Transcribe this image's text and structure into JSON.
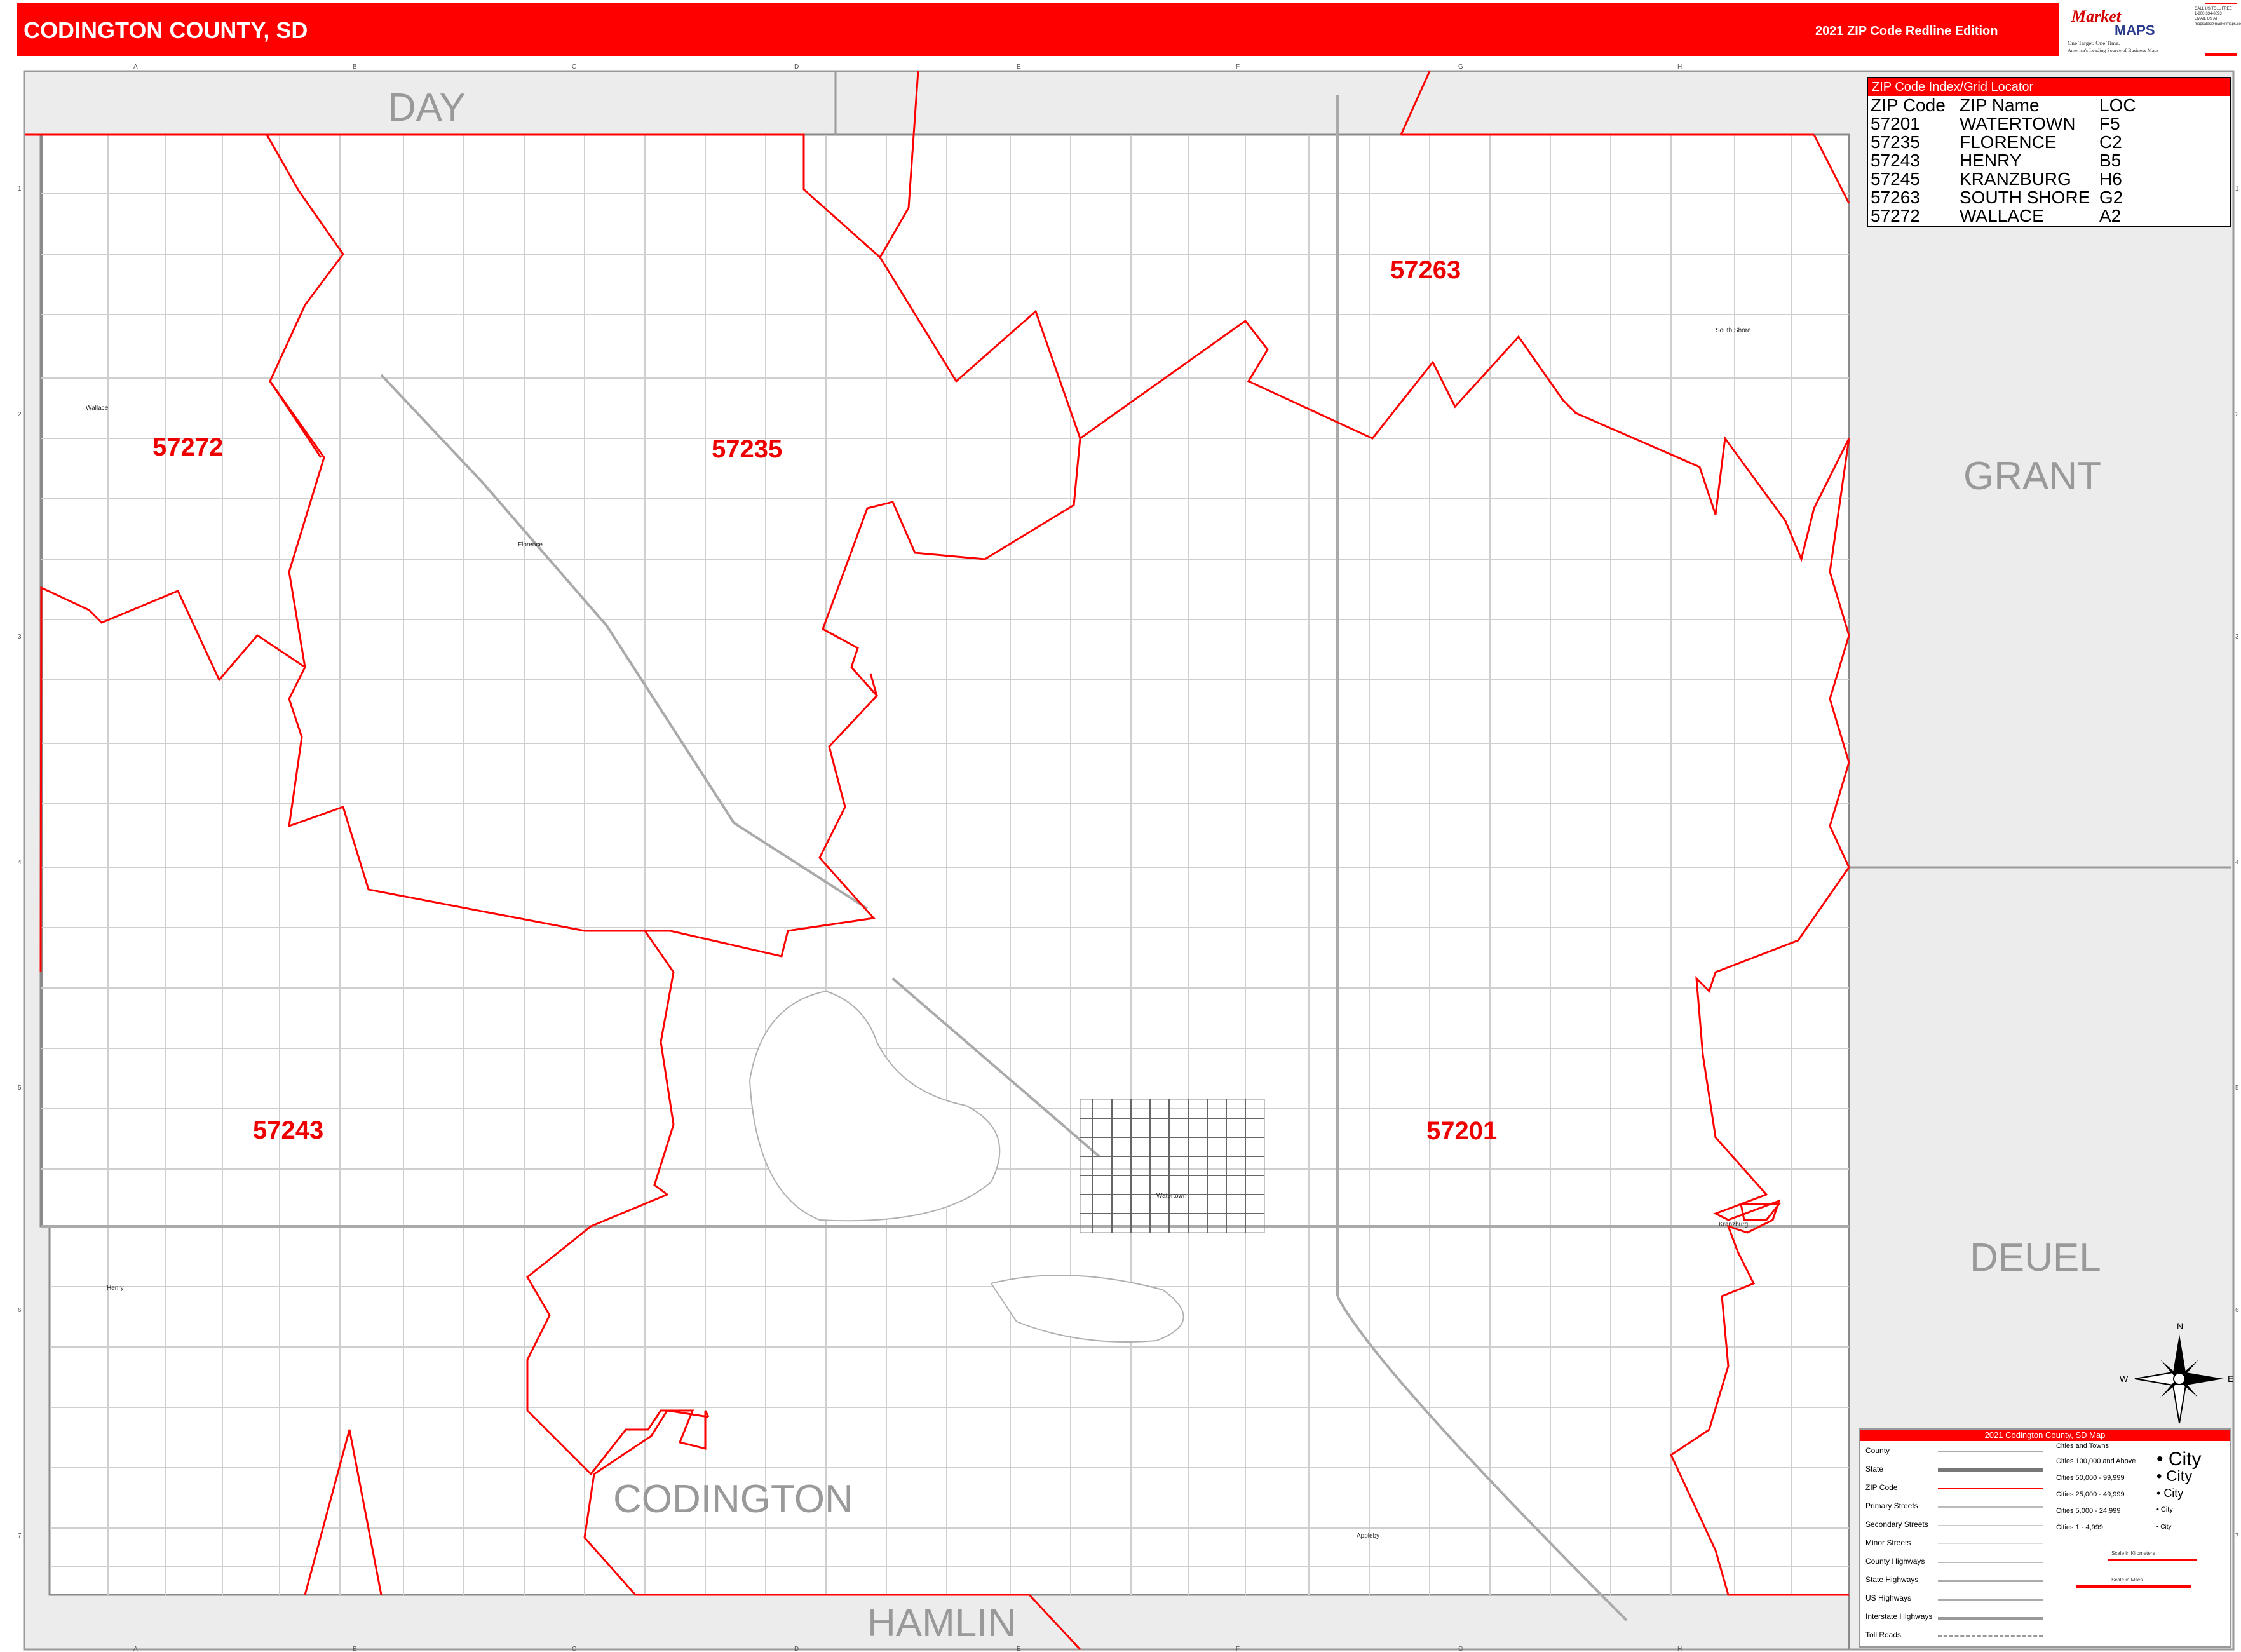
{
  "header": {
    "title": "CODINGTON COUNTY, SD",
    "edition": "2021 ZIP Code Redline Edition"
  },
  "logo": {
    "brand_top": "Market",
    "brand_bottom": "MAPS",
    "tagline": "One Target. One Time.",
    "subtagline": "America's Leading Source of Business Maps",
    "contact": "CALL US TOLL FREE 1-800-334-8093 EMAIL US AT mapsales@marketmaps.com"
  },
  "colors": {
    "zip_boundary": "#ff0000",
    "header_bg": "#ff0000",
    "outside_county": "#ececec",
    "grid_roads": "#cccccc"
  },
  "neighbors": [
    {
      "name": "DAY",
      "id": "day"
    },
    {
      "name": "GRANT",
      "id": "grant"
    },
    {
      "name": "DEUEL",
      "id": "deuel"
    },
    {
      "name": "CODINGTON",
      "id": "codington"
    },
    {
      "name": "HAMLIN",
      "id": "hamlin"
    }
  ],
  "zip_labels": [
    "57263",
    "57272",
    "57235",
    "57243",
    "57201"
  ],
  "places": [
    "Wallace",
    "Florence",
    "South Shore",
    "Watertown",
    "Kranzburg",
    "Henry",
    "Appleby"
  ],
  "grid": {
    "columns": [
      "A",
      "B",
      "C",
      "D",
      "E",
      "F",
      "G",
      "H"
    ],
    "rows": [
      "1",
      "2",
      "3",
      "4",
      "5",
      "6",
      "7"
    ]
  },
  "index": {
    "title": "ZIP Code Index/Grid Locator",
    "headers": [
      "ZIP Code",
      "ZIP Name",
      "LOC"
    ],
    "rows": [
      [
        "57201",
        "WATERTOWN",
        "F5"
      ],
      [
        "57235",
        "FLORENCE",
        "C2"
      ],
      [
        "57243",
        "HENRY",
        "B5"
      ],
      [
        "57245",
        "KRANZBURG",
        "H6"
      ],
      [
        "57263",
        "SOUTH SHORE",
        "G2"
      ],
      [
        "57272",
        "WALLACE",
        "A2"
      ]
    ]
  },
  "legend": {
    "title": "2021 Codington County, SD Map",
    "items": [
      "County",
      "State",
      "ZIP Code",
      "Primary Streets",
      "Secondary Streets",
      "Minor Streets",
      "County Highways",
      "State Highways",
      "US Highways",
      "Interstate Highways",
      "Toll Roads"
    ],
    "cities_title": "Cities and Towns",
    "city_classes": [
      "Cities 100,000 and Above",
      "Cities 50,000 - 99,999",
      "Cities 25,000 - 49,999",
      "Cities 5,000 - 24,999",
      "Cities 1 - 4,999"
    ],
    "city_word": "City",
    "scale_km": "Scale in Kilometers",
    "scale_mi": "Scale in Miles"
  }
}
